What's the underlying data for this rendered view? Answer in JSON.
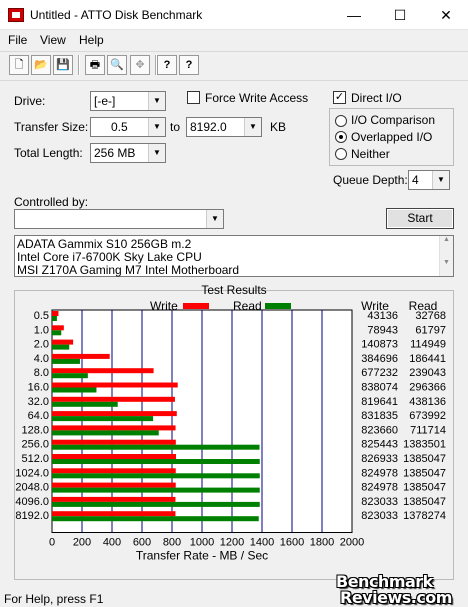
{
  "window": {
    "title": "Untitled - ATTO Disk Benchmark",
    "minimize": "—",
    "maximize": "☐",
    "close": "✕"
  },
  "menu": {
    "file": "File",
    "view": "View",
    "help": "Help"
  },
  "toolbar": {
    "new": "🗋",
    "open": "📂",
    "save": "💾",
    "print": "🖶",
    "preview": "🔍",
    "move": "✥",
    "help": "?",
    "context_help": "?"
  },
  "drive": {
    "label": "Drive:",
    "value": "[-e-]"
  },
  "force_write": {
    "label": "Force Write Access",
    "checked": false
  },
  "direct_io": {
    "label": "Direct I/O",
    "checked": true
  },
  "transfer_size": {
    "label": "Transfer Size:",
    "from": "0.5",
    "to_label": "to",
    "to": "8192.0",
    "unit": "KB"
  },
  "total_length": {
    "label": "Total Length:",
    "value": "256 MB"
  },
  "io_mode": {
    "options": [
      "I/O Comparison",
      "Overlapped I/O",
      "Neither"
    ],
    "selected": "Overlapped I/O"
  },
  "queue_depth": {
    "label": "Queue Depth:",
    "value": "4"
  },
  "controlled_by": {
    "label": "Controlled by:",
    "value": ""
  },
  "start_button": "Start",
  "description": [
    "ADATA Gammix S10 256GB m.2",
    "Intel Core i7-6700K Sky Lake CPU",
    "MSI Z170A Gaming M7 Intel Motherboard"
  ],
  "results": {
    "group_title": "Test Results",
    "write_legend": "Write",
    "read_legend": "Read",
    "write_col": "Write",
    "read_col": "Read",
    "write_color": "#ff0000",
    "read_color": "#008000"
  },
  "chart_data": {
    "type": "bar",
    "orientation": "horizontal",
    "xlabel": "Transfer Rate - MB / Sec",
    "xlim": [
      0,
      2000
    ],
    "xticks": [
      0,
      200,
      400,
      600,
      800,
      1000,
      1200,
      1400,
      1600,
      1800,
      2000
    ],
    "categories": [
      "0.5",
      "1.0",
      "2.0",
      "4.0",
      "8.0",
      "16.0",
      "32.0",
      "64.0",
      "128.0",
      "256.0",
      "512.0",
      "1024.0",
      "2048.0",
      "4096.0",
      "8192.0"
    ],
    "series": [
      {
        "name": "Write",
        "values": [
          43136,
          78943,
          140873,
          384696,
          677232,
          838074,
          819641,
          831835,
          823660,
          825443,
          826933,
          824978,
          824978,
          823033,
          823033
        ]
      },
      {
        "name": "Read",
        "values": [
          32768,
          61797,
          114949,
          186441,
          239043,
          296366,
          438136,
          673992,
          711714,
          1383501,
          1385047,
          1385047,
          1385047,
          1385047,
          1378274
        ]
      }
    ]
  },
  "status": "For Help, press F1",
  "watermark": {
    "line1": "Benchmark",
    "line2": "Reviews.com"
  }
}
